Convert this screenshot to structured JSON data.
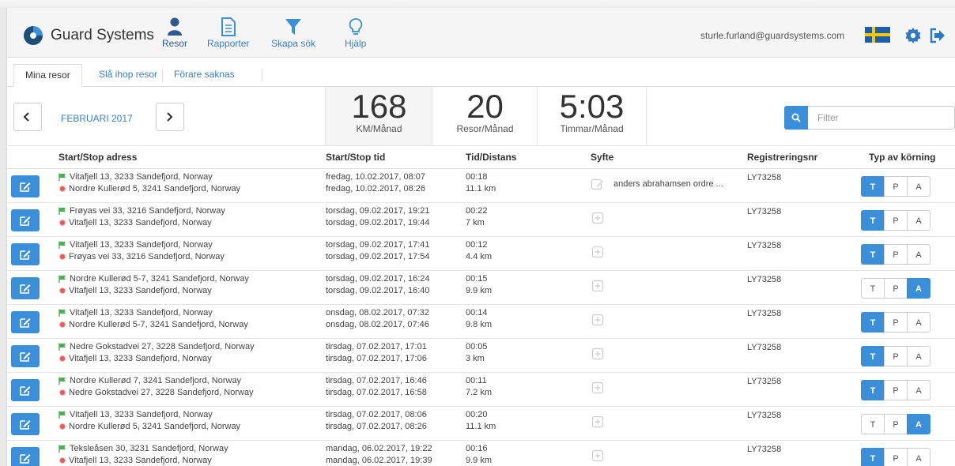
{
  "header": {
    "brand": "Guard Systems",
    "nav": [
      {
        "label": "Resor",
        "icon": "user-icon"
      },
      {
        "label": "Rapporter",
        "icon": "document-icon"
      },
      {
        "label": "Skapa sök",
        "icon": "filter-icon"
      },
      {
        "label": "Hjälp",
        "icon": "lightbulb-icon"
      }
    ],
    "user_email": "sturle.furland@guardsystems.com",
    "flag": "swedish-flag-icon"
  },
  "tabs": [
    {
      "label": "Mina resor",
      "active": true
    },
    {
      "label": "Slå ihop resor",
      "active": false
    },
    {
      "label": "Förare saknas",
      "active": false
    }
  ],
  "summary": {
    "month": "FEBRUARI 2017",
    "km_value": "168",
    "km_label": "KM/Månad",
    "trips_value": "20",
    "trips_label": "Resor/Månad",
    "hours_value": "5:03",
    "hours_label": "Timmar/Månad",
    "filter_placeholder": "Filter"
  },
  "table": {
    "headers": {
      "address": "Start/Stop adress",
      "time": "Start/Stop tid",
      "duration": "Tid/Distans",
      "purpose": "Syfte",
      "registration": "Registreringsnr",
      "type": "Typ av körning"
    },
    "type_options": [
      "T",
      "P",
      "A"
    ],
    "rows": [
      {
        "start": "Vitafjell 13, 3233 Sandefjord, Norway",
        "stop": "Nordre Kullerød 5, 3241 Sandefjord, Norway",
        "start_time": "fredag, 10.02.2017, 08:07",
        "stop_time": "fredag, 10.02.2017, 08:26",
        "duration": "00:18",
        "distance": "11.1 km",
        "purpose": "anders abrahamsen ordre ...",
        "reg": "LY73258",
        "type": "T"
      },
      {
        "start": "Frøyas vei 33, 3216 Sandefjord, Norway",
        "stop": "Vitafjell 13, 3233 Sandefjord, Norway",
        "start_time": "torsdag, 09.02.2017, 19:21",
        "stop_time": "torsdag, 09.02.2017, 19:44",
        "duration": "00:22",
        "distance": "7 km",
        "purpose": "",
        "reg": "LY73258",
        "type": "T"
      },
      {
        "start": "Vitafjell 13, 3233 Sandefjord, Norway",
        "stop": "Frøyas vei 33, 3216 Sandefjord, Norway",
        "start_time": "torsdag, 09.02.2017, 17:41",
        "stop_time": "torsdag, 09.02.2017, 17:54",
        "duration": "00:12",
        "distance": "4.4 km",
        "purpose": "",
        "reg": "LY73258",
        "type": "T"
      },
      {
        "start": "Nordre Kullerød 5-7, 3241 Sandefjord, Norway",
        "stop": "Vitafjell 13, 3233 Sandefjord, Norway",
        "start_time": "torsdag, 09.02.2017, 16:24",
        "stop_time": "torsdag, 09.02.2017, 16:40",
        "duration": "00:15",
        "distance": "9.9 km",
        "purpose": "",
        "reg": "LY73258",
        "type": "A"
      },
      {
        "start": "Vitafjell 13, 3233 Sandefjord, Norway",
        "stop": "Nordre Kullerød 5-7, 3241 Sandefjord, Norway",
        "start_time": "onsdag, 08.02.2017, 07:32",
        "stop_time": "onsdag, 08.02.2017, 07:46",
        "duration": "00:14",
        "distance": "9.8 km",
        "purpose": "",
        "reg": "LY73258",
        "type": "T"
      },
      {
        "start": "Nedre Gokstadvei 27, 3228 Sandefjord, Norway",
        "stop": "Vitafjell 13, 3233 Sandefjord, Norway",
        "start_time": "tirsdag, 07.02.2017, 17:01",
        "stop_time": "tirsdag, 07.02.2017, 17:06",
        "duration": "00:05",
        "distance": "3 km",
        "purpose": "",
        "reg": "LY73258",
        "type": "T"
      },
      {
        "start": "Nordre Kullerød 7, 3241 Sandefjord, Norway",
        "stop": "Nedre Gokstadvei 27, 3228 Sandefjord, Norway",
        "start_time": "tirsdag, 07.02.2017, 16:46",
        "stop_time": "tirsdag, 07.02.2017, 16:58",
        "duration": "00:11",
        "distance": "7.2 km",
        "purpose": "",
        "reg": "LY73258",
        "type": "T"
      },
      {
        "start": "Vitafjell 13, 3233 Sandefjord, Norway",
        "stop": "Nordre Kullerød 5, 3241 Sandefjord, Norway",
        "start_time": "tirsdag, 07.02.2017, 08:06",
        "stop_time": "tirsdag, 07.02.2017, 08:26",
        "duration": "00:20",
        "distance": "11.1 km",
        "purpose": "",
        "reg": "LY73258",
        "type": "A"
      },
      {
        "start": "Teksleåsen 30, 3231 Sandefjord, Norway",
        "stop": "Vitafjell 13, 3233 Sandefjord, Norway",
        "start_time": "mandag, 06.02.2017, 19:22",
        "stop_time": "mandag, 06.02.2017, 19:39",
        "duration": "00:16",
        "distance": "9.9 km",
        "purpose": "",
        "reg": "LY73258",
        "type": "T"
      }
    ]
  },
  "colors": {
    "accent": "#3a8fd8",
    "link": "#3a7fc8",
    "stop": "#e25c5c",
    "start": "#4caf50"
  }
}
